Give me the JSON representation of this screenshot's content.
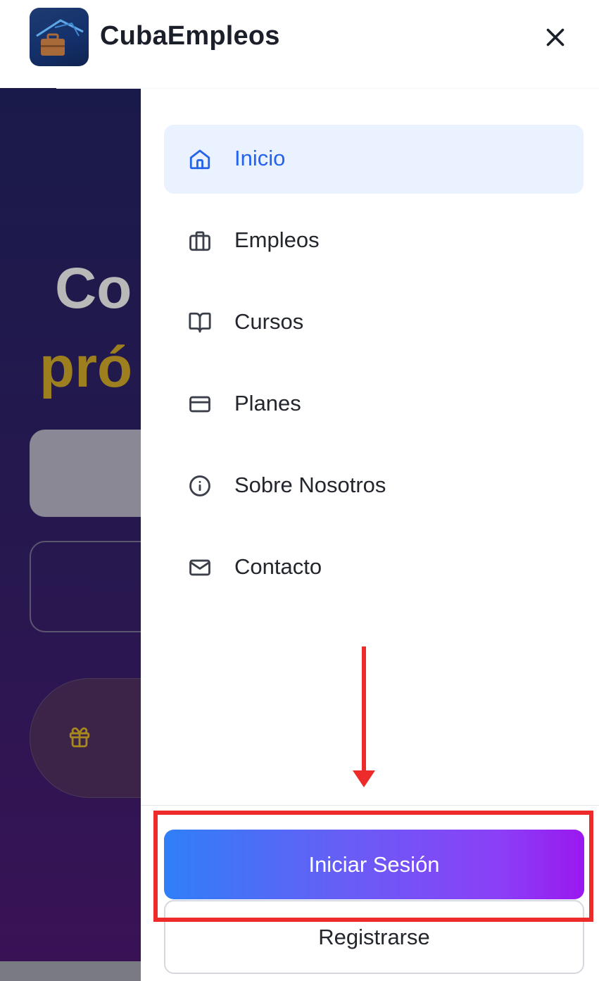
{
  "header": {
    "brand": "CubaEmpleos",
    "logo_icon": "briefcase-logo-icon",
    "close_icon": "close-icon"
  },
  "background_page": {
    "hero_line1": "Co",
    "hero_line2": "pró",
    "gift_icon": "gift-icon"
  },
  "menu": {
    "items": [
      {
        "label": "Inicio",
        "icon": "home-icon",
        "active": true
      },
      {
        "label": "Empleos",
        "icon": "briefcase-icon",
        "active": false
      },
      {
        "label": "Cursos",
        "icon": "book-icon",
        "active": false
      },
      {
        "label": "Planes",
        "icon": "credit-card-icon",
        "active": false
      },
      {
        "label": "Sobre Nosotros",
        "icon": "info-icon",
        "active": false
      },
      {
        "label": "Contacto",
        "icon": "mail-icon",
        "active": false
      }
    ]
  },
  "auth": {
    "login_label": "Iniciar Sesión",
    "register_label": "Registrarse"
  },
  "colors": {
    "accent": "#2563eb",
    "active_bg": "#e9f2fe",
    "gradient_start": "#2f7ff8",
    "gradient_end": "#9a18f0",
    "annotation": "#ee2b2b"
  }
}
